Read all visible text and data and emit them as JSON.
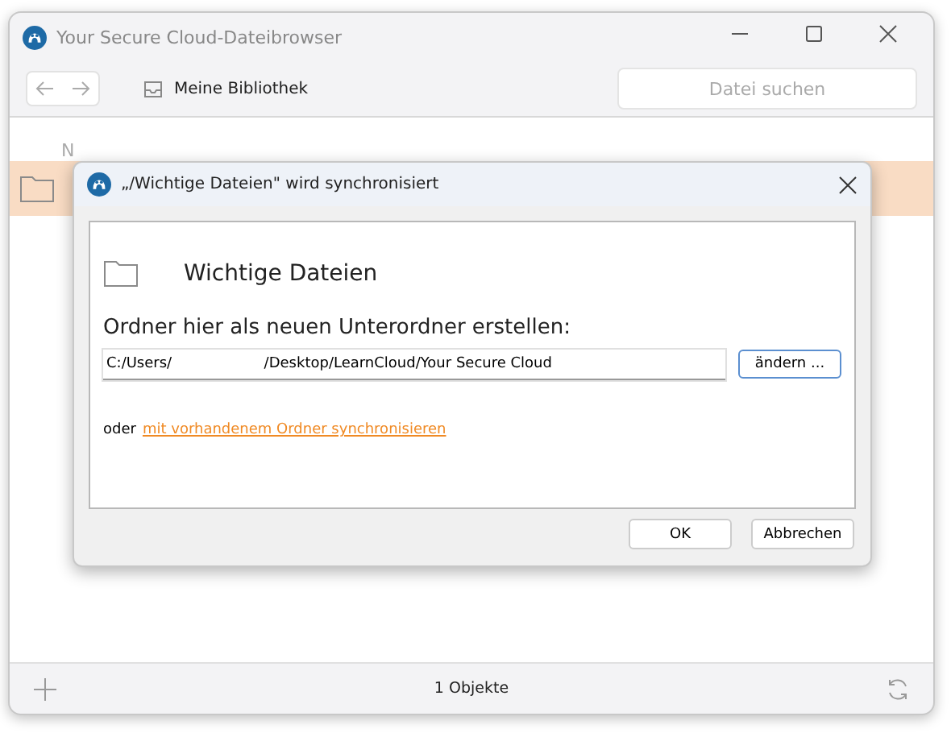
{
  "window": {
    "title": "Your Secure Cloud-Dateibrowser"
  },
  "toolbar": {
    "location": "Meine Bibliothek",
    "search": {
      "placeholder": "Datei suchen"
    }
  },
  "table": {
    "columns": [
      "N"
    ],
    "rows": [
      {
        "selected": true
      }
    ]
  },
  "status_bar": {
    "count": "1 Objekte"
  },
  "dialog": {
    "title": "„/Wichtige Dateien\" wird synchronisiert",
    "folder_name": "Wichtige Dateien",
    "prompt": "Ordner hier als neuen Unterordner erstellen:",
    "path": {
      "value": "C:/Users/                    /Desktop/LearnCloud/Your Secure Cloud"
    },
    "change_button": "ändern ...",
    "alt_prefix": "oder",
    "alt_link": "mit vorhandenem Ordner synchronisieren",
    "buttons": [
      "OK",
      "Abbrechen"
    ]
  }
}
